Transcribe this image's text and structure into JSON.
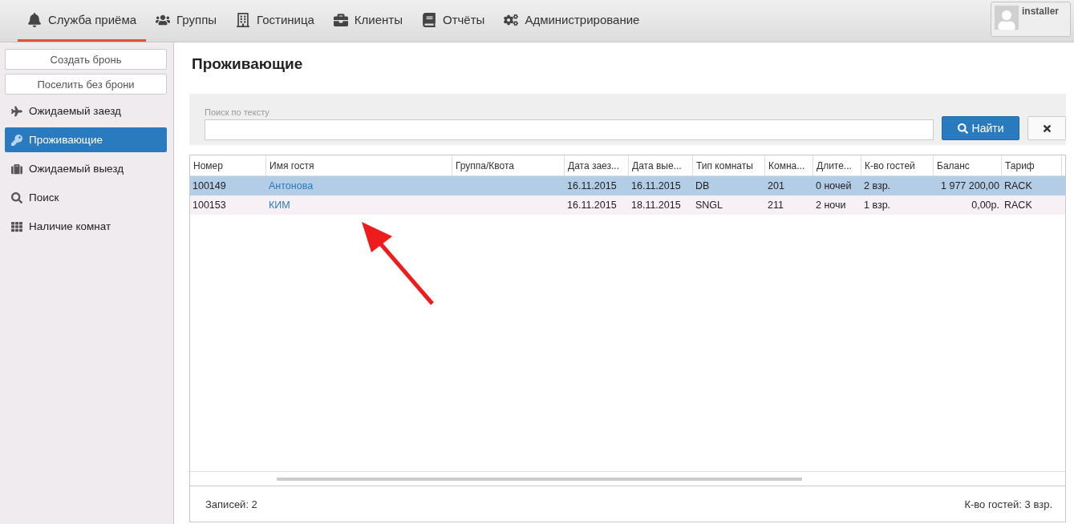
{
  "nav": {
    "tabs": [
      {
        "label": "Служба приёма",
        "selected": true
      },
      {
        "label": "Группы",
        "selected": false
      },
      {
        "label": "Гостиница",
        "selected": false
      },
      {
        "label": "Клиенты",
        "selected": false
      },
      {
        "label": "Отчёты",
        "selected": false
      },
      {
        "label": "Администрирование",
        "selected": false
      }
    ],
    "user": {
      "name": "installer"
    }
  },
  "sidebar": {
    "buttons": [
      "Создать бронь",
      "Поселить без брони"
    ],
    "items": [
      {
        "label": "Ожидаемый заезд",
        "selected": false
      },
      {
        "label": "Проживающие",
        "selected": true
      },
      {
        "label": "Ожидаемый выезд",
        "selected": false
      },
      {
        "label": "Поиск",
        "selected": false
      },
      {
        "label": "Наличие комнат",
        "selected": false
      }
    ]
  },
  "page": {
    "title": "Проживающие"
  },
  "search": {
    "label": "Поиск по тексту",
    "find_button": "Найти"
  },
  "table": {
    "columns": [
      {
        "label": "Номер"
      },
      {
        "label": "Имя гостя",
        "kind": "link"
      },
      {
        "label": "Группа/Квота"
      },
      {
        "label": "Дата заез..."
      },
      {
        "label": "Дата вые..."
      },
      {
        "label": "Тип комнаты"
      },
      {
        "label": "Комна..."
      },
      {
        "label": "Длите..."
      },
      {
        "label": "К-во гостей"
      },
      {
        "label": "Баланс",
        "kind": "number"
      },
      {
        "label": "Тариф"
      }
    ],
    "rows": [
      {
        "selected": true,
        "cells": [
          "100149",
          "Антонова",
          "",
          "16.11.2015",
          "16.11.2015",
          "DB",
          "201",
          "0 ночей",
          "2 взр.",
          "1 977 200,00",
          "RACK"
        ]
      },
      {
        "selected": false,
        "cells": [
          "100153",
          "КИМ",
          "",
          "16.11.2015",
          "18.11.2015",
          "SNGL",
          "211",
          "2 ночи",
          "1 взр.",
          "0,00р.",
          "RACK"
        ]
      }
    ]
  },
  "footer": {
    "records": "Записей: 2",
    "guests": "К-во гостей: 3 взр."
  }
}
